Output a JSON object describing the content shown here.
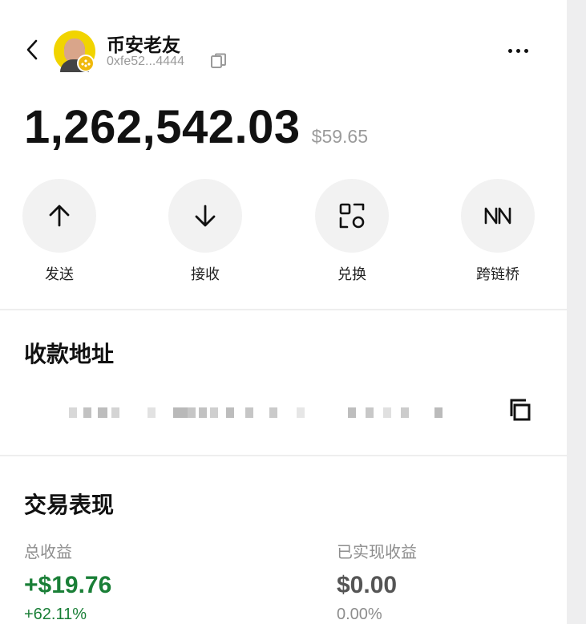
{
  "header": {
    "account_name": "币安老友",
    "account_address": "0xfe52...4444"
  },
  "balance": {
    "amount": "1,262,542.03",
    "fiat_value": "$59.65"
  },
  "actions": [
    {
      "label": "发送",
      "icon": "arrow-up-icon"
    },
    {
      "label": "接收",
      "icon": "arrow-down-icon"
    },
    {
      "label": "兑换",
      "icon": "swap-icon"
    },
    {
      "label": "跨链桥",
      "icon": "bridge-icon"
    }
  ],
  "receive_address": {
    "title": "收款地址",
    "obscured": true
  },
  "performance": {
    "title": "交易表现",
    "total_profit_label": "总收益",
    "total_profit_value": "+$19.76",
    "total_profit_percent": "+62.11%",
    "realized_profit_label": "已实现收益",
    "realized_profit_value": "$0.00",
    "realized_profit_percent": "0.00%"
  },
  "colors": {
    "positive": "#1a7f37",
    "muted": "#8d8d8d",
    "neutral_value": "#555555",
    "badge": "#f0b90b",
    "button_bg": "#f2f2f2"
  }
}
